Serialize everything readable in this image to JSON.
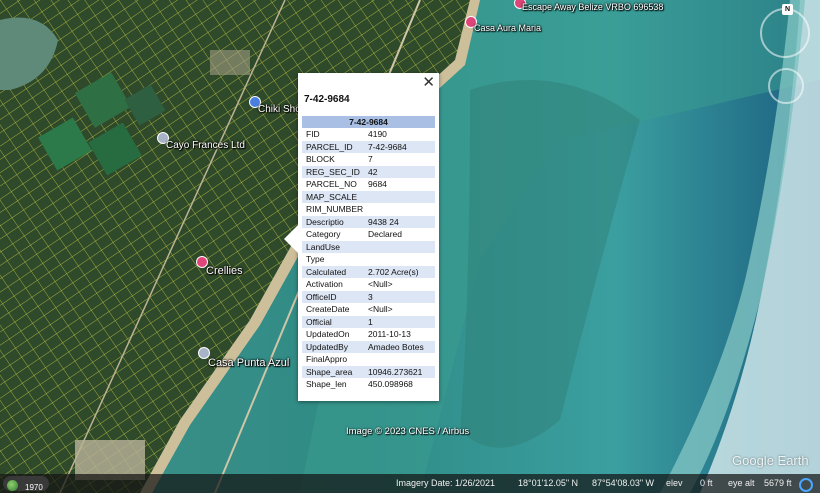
{
  "map": {
    "labels": {
      "escape_away": "Escape Away Belize VRBO 696538",
      "casa_aura": "Casa Aura Maria",
      "chiki": "Chiki Sho",
      "cayo": "Cayo Frances Ltd",
      "crellies": "Crellies",
      "casa_punta": "Casa Punta Azul"
    },
    "attribution": "Image © 2023 CNES / Airbus",
    "logo": "Google Earth",
    "compass_label": "N"
  },
  "balloon": {
    "close_label": "✕",
    "title": "7-42-9684",
    "table_header": "7-42-9684",
    "rows": [
      {
        "key": "FID",
        "value": "4190"
      },
      {
        "key": "PARCEL_ID",
        "value": "7-42-9684"
      },
      {
        "key": "BLOCK",
        "value": "7"
      },
      {
        "key": "REG_SEC_ID",
        "value": "42"
      },
      {
        "key": "PARCEL_NO",
        "value": "9684"
      },
      {
        "key": "MAP_SCALE",
        "value": ""
      },
      {
        "key": "RIM_NUMBER",
        "value": ""
      },
      {
        "key": "Descriptio",
        "value": "9438 24"
      },
      {
        "key": "Category",
        "value": "Declared"
      },
      {
        "key": "LandUse",
        "value": ""
      },
      {
        "key": "Type",
        "value": ""
      },
      {
        "key": "Calculated",
        "value": "2.702 Acre(s)"
      },
      {
        "key": "Activation",
        "value": "<Null>"
      },
      {
        "key": "OfficeID",
        "value": "3"
      },
      {
        "key": "CreateDate",
        "value": "<Null>"
      },
      {
        "key": "Official",
        "value": "1"
      },
      {
        "key": "UpdatedOn",
        "value": "2011-10-13"
      },
      {
        "key": "UpdatedBy",
        "value": "Amadeo Botes"
      },
      {
        "key": "FinalAppro",
        "value": ""
      },
      {
        "key": "Shape_area",
        "value": "10946.273621"
      },
      {
        "key": "Shape_len",
        "value": "450.098968"
      }
    ]
  },
  "status_bar": {
    "year": "1970",
    "imagery_date": "Imagery Date: 1/26/2021",
    "latitude": "18°01'12.05\" N",
    "longitude": "87°54'08.03\" W",
    "elev_label": "elev",
    "elev_value": "0 ft",
    "eye_alt_label": "eye alt",
    "eye_alt_value": "5679 ft"
  },
  "colors": {
    "parcel_lines": "#e6e64a",
    "table_header": "#a9c0e4",
    "table_alt_row": "#dde6f4",
    "lagoon": "#3aa89a",
    "reef_surf": "#cfe6ea"
  }
}
